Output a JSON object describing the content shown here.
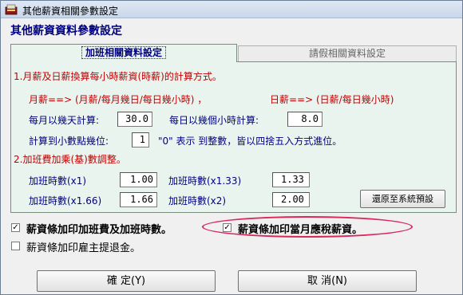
{
  "window": {
    "title": "其他薪資相關參數設定"
  },
  "header": "其他薪資資料參數設定",
  "tabs": [
    {
      "label": "加班相關資料設定",
      "active": true
    },
    {
      "label": "請假相關資料設定",
      "active": false
    }
  ],
  "section1": {
    "heading": "1.月薪及日薪換算每小時薪資(時薪)的計算方式。",
    "formula_monthly": "月薪==> (月薪/每月幾日/每日幾小時) ，",
    "formula_daily": "日薪==> (日薪/每日幾小時)",
    "days_label": "每月以幾天計算:",
    "days_value": "30.0",
    "hours_label": "每日以幾個小時計算:",
    "hours_value": "8.0",
    "decimal_label": "計算到小數點幾位:",
    "decimal_value": "1",
    "decimal_note": "\"0\" 表示 到整數，皆以四捨五入方式進位。"
  },
  "section2": {
    "heading": "2.加班費加乘(基)數調整。",
    "rows": [
      {
        "label": "加班時數(x1)",
        "value": "1.00"
      },
      {
        "label": "加班時數(x1.33)",
        "value": "1.33"
      },
      {
        "label": "加班時數(x1.66)",
        "value": "1.66"
      },
      {
        "label": "加班時數(x2)",
        "value": "2.00"
      }
    ],
    "reset_button": "還原至系統預設"
  },
  "checkboxes": [
    {
      "label": "薪資條加印加班費及加班時數。",
      "checked": true
    },
    {
      "label": "薪資條加印當月應稅薪資。",
      "checked": true
    },
    {
      "label": "薪資條加印雇主提退金。",
      "checked": false
    }
  ],
  "buttons": {
    "ok": "確 定(Y)",
    "cancel": "取 消(N)"
  },
  "colors": {
    "accent_red": "#c00000",
    "navy": "#000080",
    "highlight": "#d8285c"
  }
}
